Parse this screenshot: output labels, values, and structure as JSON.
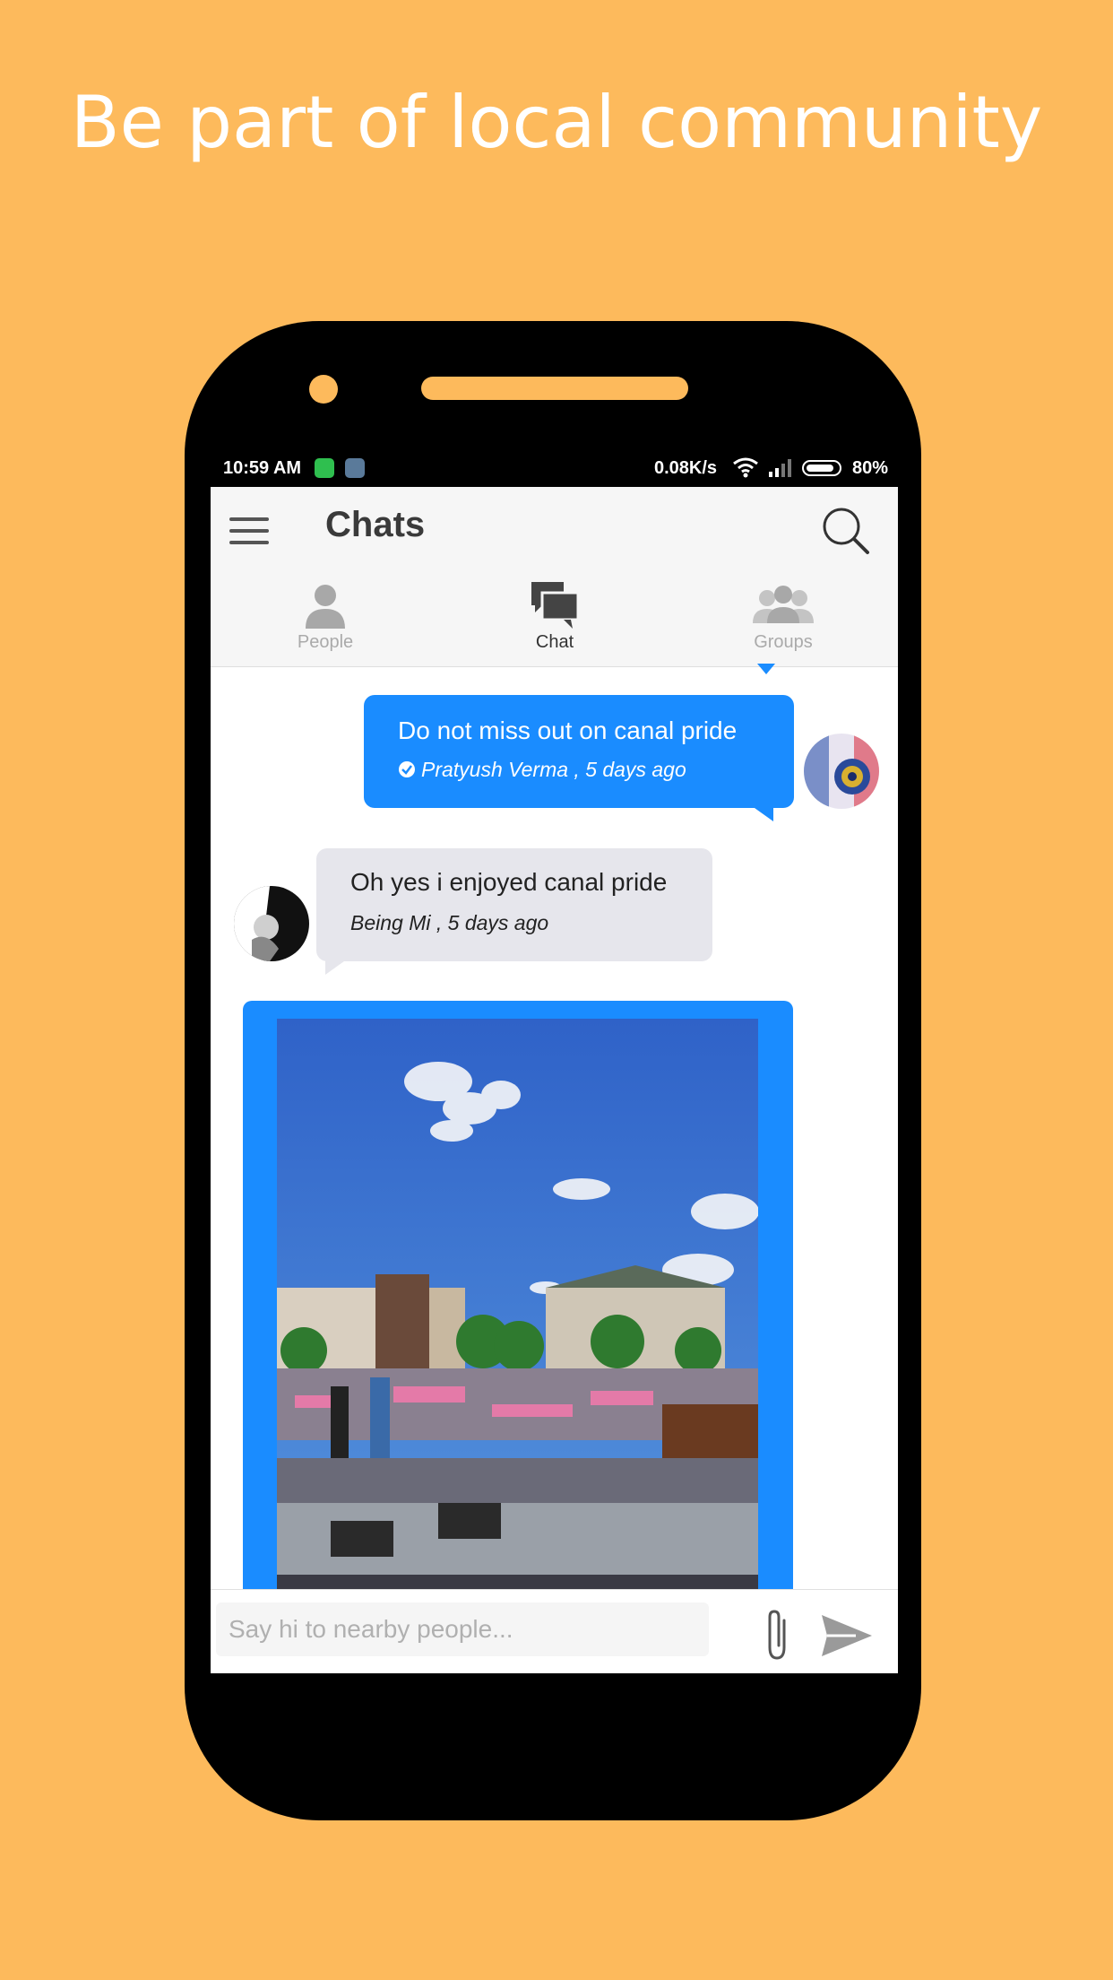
{
  "promo": {
    "headline": "Be part of local community"
  },
  "status_bar": {
    "time": "10:59 AM",
    "net_speed": "0.08K/s",
    "battery_pct": "80%"
  },
  "app_bar": {
    "title": "Chats"
  },
  "tabs": [
    {
      "label": "People",
      "icon": "person-icon",
      "active": false
    },
    {
      "label": "Chat",
      "icon": "chat-bubbles-icon",
      "active": true
    },
    {
      "label": "Groups",
      "icon": "group-icon",
      "active": false
    }
  ],
  "messages": [
    {
      "direction": "outgoing",
      "text": "Do not miss out on canal pride",
      "meta": "Pratyush Verma , 5 days ago",
      "verified": true
    },
    {
      "direction": "incoming",
      "text": "Oh yes i enjoyed canal pride",
      "meta": "Being Mi , 5 days ago"
    },
    {
      "direction": "outgoing",
      "type": "image",
      "image": "canal-pride-photo"
    }
  ],
  "composer": {
    "placeholder": "Say hi to nearby people..."
  },
  "colors": {
    "background": "#fdba5c",
    "bubble_out": "#1a8cff",
    "bubble_in": "#e6e6ec"
  }
}
